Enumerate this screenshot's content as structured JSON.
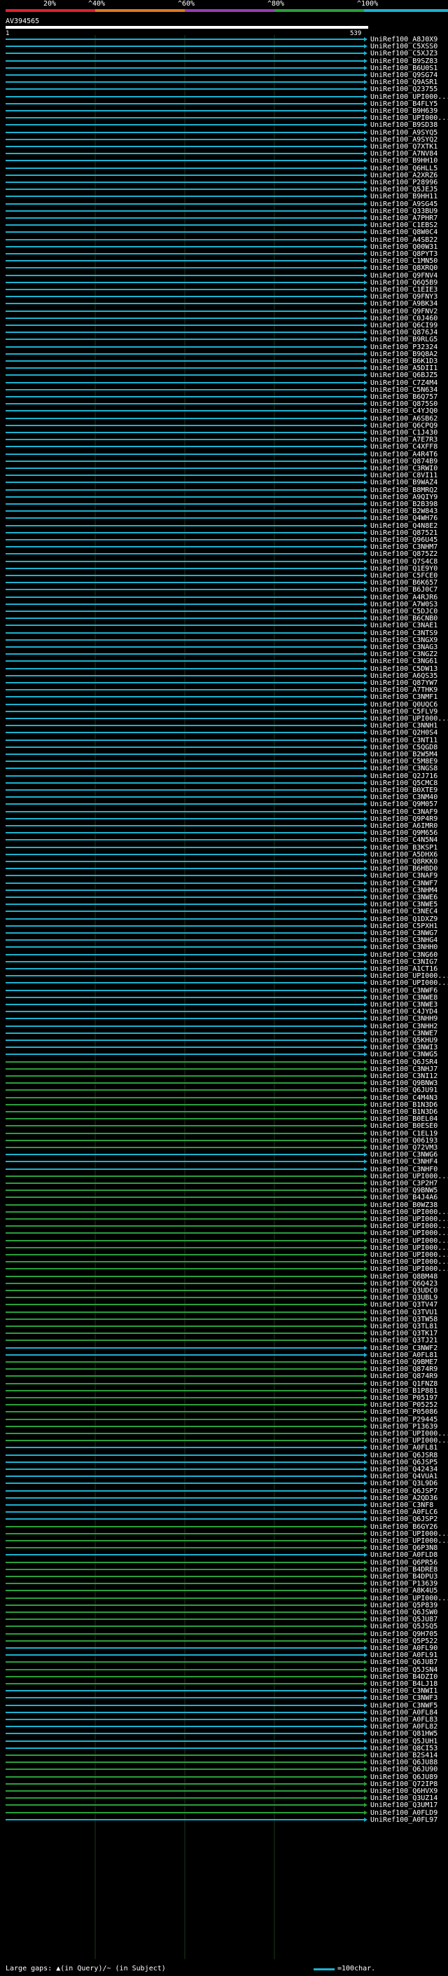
{
  "legend": {
    "labels": [
      "20%",
      "^40%",
      "^60%",
      "^80%",
      "^100%"
    ],
    "colors": [
      "#e0202c",
      "#e07820",
      "#9b3bb5",
      "#28a03c",
      "#1ab3d1"
    ]
  },
  "query": {
    "title": "AV394565",
    "ruler_start": "1",
    "ruler_end": "539"
  },
  "hits": [
    {
      "label": "UniRef100_A8J0X9",
      "color": "blue"
    },
    {
      "label": "UniRef100_C5XSS0",
      "color": "blue"
    },
    {
      "label": "UniRef100_C5XJZ3",
      "color": "blue"
    },
    {
      "label": "UniRef100_B9SZ83",
      "color": "blue"
    },
    {
      "label": "UniRef100_B6U0S1",
      "color": "blue"
    },
    {
      "label": "UniRef100_Q9SG74",
      "color": "blue"
    },
    {
      "label": "UniRef100_Q9ASR1",
      "color": "blue"
    },
    {
      "label": "UniRef100_Q23755",
      "color": "blue"
    },
    {
      "label": "UniRef100_UPI000...",
      "color": "blue"
    },
    {
      "label": "UniRef100_B4FLY5",
      "color": "blue"
    },
    {
      "label": "UniRef100_B9H639",
      "color": "blue"
    },
    {
      "label": "UniRef100_UPI000...",
      "color": "blue"
    },
    {
      "label": "UniRef100_B9SD38",
      "color": "blue"
    },
    {
      "label": "UniRef100_A9SYQ5",
      "color": "blue"
    },
    {
      "label": "UniRef100_A9SYQ2",
      "color": "blue"
    },
    {
      "label": "UniRef100_Q7XTK1",
      "color": "blue"
    },
    {
      "label": "UniRef100_A7NV84",
      "color": "blue"
    },
    {
      "label": "UniRef100_B9HH10",
      "color": "blue"
    },
    {
      "label": "UniRef100_Q6HLL5",
      "color": "blue"
    },
    {
      "label": "UniRef100_A2XRZ6",
      "color": "blue"
    },
    {
      "label": "UniRef100_P28996",
      "color": "blue"
    },
    {
      "label": "UniRef100_Q5JEJ5",
      "color": "blue"
    },
    {
      "label": "UniRef100_B9HH11",
      "color": "blue"
    },
    {
      "label": "UniRef100_A9SG45",
      "color": "blue"
    },
    {
      "label": "UniRef100_Q33BU9",
      "color": "blue"
    },
    {
      "label": "UniRef100_A7PHR7",
      "color": "blue"
    },
    {
      "label": "UniRef100_C1EBS2",
      "color": "blue"
    },
    {
      "label": "UniRef100_Q8W0C4",
      "color": "blue"
    },
    {
      "label": "UniRef100_A4SB22",
      "color": "blue"
    },
    {
      "label": "UniRef100_Q00W31",
      "color": "blue"
    },
    {
      "label": "UniRef100_Q8PYT3",
      "color": "blue"
    },
    {
      "label": "UniRef100_C1MN50",
      "color": "blue"
    },
    {
      "label": "UniRef100_Q8XRQ0",
      "color": "blue"
    },
    {
      "label": "UniRef100_Q9FNV4",
      "color": "blue"
    },
    {
      "label": "UniRef100_Q6Q5B9",
      "color": "blue"
    },
    {
      "label": "UniRef100_C1EIE3",
      "color": "blue"
    },
    {
      "label": "UniRef100_Q9FNY3",
      "color": "blue"
    },
    {
      "label": "UniRef100_A9BK34",
      "color": "blue"
    },
    {
      "label": "UniRef100_Q9FNV2",
      "color": "blue"
    },
    {
      "label": "UniRef100_C0J460",
      "color": "blue"
    },
    {
      "label": "UniRef100_Q6CI99",
      "color": "blue"
    },
    {
      "label": "UniRef100_Q876J4",
      "color": "blue"
    },
    {
      "label": "UniRef100_B9RLG5",
      "color": "blue"
    },
    {
      "label": "UniRef100_P32324",
      "color": "blue"
    },
    {
      "label": "UniRef100_B9Q8A2",
      "color": "blue"
    },
    {
      "label": "UniRef100_B6K1D3",
      "color": "blue"
    },
    {
      "label": "UniRef100_A5DII1",
      "color": "blue"
    },
    {
      "label": "UniRef100_Q6BJZ5",
      "color": "blue"
    },
    {
      "label": "UniRef100_C7Z4M4",
      "color": "blue"
    },
    {
      "label": "UniRef100_C5N634",
      "color": "blue"
    },
    {
      "label": "UniRef100_B6Q757",
      "color": "blue"
    },
    {
      "label": "UniRef100_Q875S0",
      "color": "blue"
    },
    {
      "label": "UniRef100_C4YJQ0",
      "color": "blue"
    },
    {
      "label": "UniRef100_A6SB62",
      "color": "blue"
    },
    {
      "label": "UniRef100_Q6CPQ9",
      "color": "blue"
    },
    {
      "label": "UniRef100_C1J430",
      "color": "blue"
    },
    {
      "label": "UniRef100_A7E7R3",
      "color": "blue"
    },
    {
      "label": "UniRef100_C4XFF8",
      "color": "blue"
    },
    {
      "label": "UniRef100_A4R4T6",
      "color": "blue"
    },
    {
      "label": "UniRef100_Q874B9",
      "color": "blue"
    },
    {
      "label": "UniRef100_C3RWI0",
      "color": "blue"
    },
    {
      "label": "UniRef100_C8VI11",
      "color": "blue"
    },
    {
      "label": "UniRef100_B9WAZ4",
      "color": "blue"
    },
    {
      "label": "UniRef100_B8MRQ2",
      "color": "blue"
    },
    {
      "label": "UniRef100_A9QIY9",
      "color": "blue"
    },
    {
      "label": "UniRef100_B2B398",
      "color": "blue"
    },
    {
      "label": "UniRef100_B2W843",
      "color": "blue"
    },
    {
      "label": "UniRef100_Q4WH76",
      "color": "blue"
    },
    {
      "label": "UniRef100_Q4N8E2",
      "color": "blue"
    },
    {
      "label": "UniRef100_Q87521",
      "color": "blue"
    },
    {
      "label": "UniRef100_Q96U45",
      "color": "blue"
    },
    {
      "label": "UniRef100_C3NHM7",
      "color": "blue"
    },
    {
      "label": "UniRef100_Q875Z2",
      "color": "blue"
    },
    {
      "label": "UniRef100_Q7S4C8",
      "color": "blue"
    },
    {
      "label": "UniRef100_Q1E9Y0",
      "color": "blue"
    },
    {
      "label": "UniRef100_C5FCE0",
      "color": "blue"
    },
    {
      "label": "UniRef100_B6K657",
      "color": "blue"
    },
    {
      "label": "UniRef100_B6J0C7",
      "color": "blue"
    },
    {
      "label": "UniRef100_A4RJR6",
      "color": "blue"
    },
    {
      "label": "UniRef100_A7W0S3",
      "color": "blue"
    },
    {
      "label": "UniRef100_C5DJC0",
      "color": "blue"
    },
    {
      "label": "UniRef100_B6CNB0",
      "color": "blue"
    },
    {
      "label": "UniRef100_C3NAE1",
      "color": "blue"
    },
    {
      "label": "UniRef100_C3NTS9",
      "color": "blue"
    },
    {
      "label": "UniRef100_C3NGX9",
      "color": "blue"
    },
    {
      "label": "UniRef100_C3NAG3",
      "color": "blue"
    },
    {
      "label": "UniRef100_C3NGZ2",
      "color": "blue"
    },
    {
      "label": "UniRef100_C3NG61",
      "color": "blue"
    },
    {
      "label": "UniRef100_C5DW13",
      "color": "blue"
    },
    {
      "label": "UniRef100_A6QS35",
      "color": "blue"
    },
    {
      "label": "UniRef100_Q87YW7",
      "color": "blue"
    },
    {
      "label": "UniRef100_A7THK9",
      "color": "blue"
    },
    {
      "label": "UniRef100_C3NMF1",
      "color": "blue"
    },
    {
      "label": "UniRef100_Q0UQC6",
      "color": "blue"
    },
    {
      "label": "UniRef100_C5FLV9",
      "color": "blue"
    },
    {
      "label": "UniRef100_UPI000...",
      "color": "blue"
    },
    {
      "label": "UniRef100_C3NNH1",
      "color": "blue"
    },
    {
      "label": "UniRef100_Q2H0S4",
      "color": "blue"
    },
    {
      "label": "UniRef100_C3NT11",
      "color": "blue"
    },
    {
      "label": "UniRef100_C5QGD8",
      "color": "blue"
    },
    {
      "label": "UniRef100_B2W5M4",
      "color": "blue"
    },
    {
      "label": "UniRef100_C5M8E9",
      "color": "blue"
    },
    {
      "label": "UniRef100_C3NGS8",
      "color": "blue"
    },
    {
      "label": "UniRef100_Q2J716",
      "color": "blue"
    },
    {
      "label": "UniRef100_Q5CMC8",
      "color": "blue"
    },
    {
      "label": "UniRef100_B0XTE9",
      "color": "blue"
    },
    {
      "label": "UniRef100_C3NM40",
      "color": "blue"
    },
    {
      "label": "UniRef100_Q9M057",
      "color": "blue"
    },
    {
      "label": "UniRef100_C3NAF9",
      "color": "blue"
    },
    {
      "label": "UniRef100_Q9P4R9",
      "color": "blue"
    },
    {
      "label": "UniRef100_A6IMR0",
      "color": "blue"
    },
    {
      "label": "UniRef100_Q9M656",
      "color": "blue"
    },
    {
      "label": "UniRef100_C4N5N4",
      "color": "blue"
    },
    {
      "label": "UniRef100_B3KSP1",
      "color": "blue"
    },
    {
      "label": "UniRef100_A5DHX6",
      "color": "blue"
    },
    {
      "label": "UniRef100_Q8RKK0",
      "color": "blue"
    },
    {
      "label": "UniRef100_B6HBD0",
      "color": "blue"
    },
    {
      "label": "UniRef100_C3NAF9",
      "color": "blue"
    },
    {
      "label": "UniRef100_C3NWF7",
      "color": "blue"
    },
    {
      "label": "UniRef100_C3NHM4",
      "color": "blue"
    },
    {
      "label": "UniRef100_C3NWE6",
      "color": "blue"
    },
    {
      "label": "UniRef100_C3NWE5",
      "color": "blue"
    },
    {
      "label": "UniRef100_C3NEC4",
      "color": "blue"
    },
    {
      "label": "UniRef100_Q1DXZ9",
      "color": "blue"
    },
    {
      "label": "UniRef100_C5PXH1",
      "color": "blue"
    },
    {
      "label": "UniRef100_C3NWG7",
      "color": "blue"
    },
    {
      "label": "UniRef100_C3NHG4",
      "color": "blue"
    },
    {
      "label": "UniRef100_C3NHH0",
      "color": "blue"
    },
    {
      "label": "UniRef100_C3NG60",
      "color": "blue"
    },
    {
      "label": "UniRef100_C3NIG7",
      "color": "blue"
    },
    {
      "label": "UniRef100_A1CT16",
      "color": "blue"
    },
    {
      "label": "UniRef100_UPI000...",
      "color": "blue"
    },
    {
      "label": "UniRef100_UPI000...",
      "color": "blue"
    },
    {
      "label": "UniRef100_C3NWF6",
      "color": "blue"
    },
    {
      "label": "UniRef100_C3NWE8",
      "color": "blue"
    },
    {
      "label": "UniRef100_C3NWE3",
      "color": "blue"
    },
    {
      "label": "UniRef100_C4JYD4",
      "color": "blue"
    },
    {
      "label": "UniRef100_C3NHH9",
      "color": "blue"
    },
    {
      "label": "UniRef100_C3NHH2",
      "color": "blue"
    },
    {
      "label": "UniRef100_C3NWE7",
      "color": "blue"
    },
    {
      "label": "UniRef100_Q5KHU9",
      "color": "blue"
    },
    {
      "label": "UniRef100_C3NWI3",
      "color": "blue"
    },
    {
      "label": "UniRef100_C3NWG5",
      "color": "blue"
    },
    {
      "label": "UniRef100_Q6JSR4",
      "color": "green"
    },
    {
      "label": "UniRef100_C3NHJ7",
      "color": "green"
    },
    {
      "label": "UniRef100_C3NI12",
      "color": "green"
    },
    {
      "label": "UniRef100_Q9BNW3",
      "color": "green"
    },
    {
      "label": "UniRef100_Q6JU91",
      "color": "green"
    },
    {
      "label": "UniRef100_C4M4N3",
      "color": "green"
    },
    {
      "label": "UniRef100_B1N3D6",
      "color": "green"
    },
    {
      "label": "UniRef100_B1N3D6",
      "color": "green"
    },
    {
      "label": "UniRef100_B0EL04",
      "color": "green"
    },
    {
      "label": "UniRef100_B0ESE0",
      "color": "green"
    },
    {
      "label": "UniRef100_C1EL19",
      "color": "green"
    },
    {
      "label": "UniRef100_Q06193",
      "color": "green"
    },
    {
      "label": "UniRef100_Q72VM3",
      "color": "green"
    },
    {
      "label": "UniRef100_C3NWG6",
      "color": "blue"
    },
    {
      "label": "UniRef100_C3NHF4",
      "color": "blue"
    },
    {
      "label": "UniRef100_C3NHF0",
      "color": "blue"
    },
    {
      "label": "UniRef100_UPI000...",
      "color": "green"
    },
    {
      "label": "UniRef100_C3P2H7",
      "color": "green"
    },
    {
      "label": "UniRef100_Q9BNW5",
      "color": "green"
    },
    {
      "label": "UniRef100_B4J4A6",
      "color": "green"
    },
    {
      "label": "UniRef100_B0WZ38",
      "color": "green"
    },
    {
      "label": "UniRef100_UPI000...",
      "color": "green"
    },
    {
      "label": "UniRef100_UPI000...",
      "color": "green"
    },
    {
      "label": "UniRef100_UPI000...",
      "color": "green"
    },
    {
      "label": "UniRef100_UPI000...",
      "color": "green"
    },
    {
      "label": "UniRef100_UPI000...",
      "color": "green"
    },
    {
      "label": "UniRef100_UPI000...",
      "color": "green"
    },
    {
      "label": "UniRef100_UPI000...",
      "color": "green"
    },
    {
      "label": "UniRef100_UPI000...",
      "color": "green"
    },
    {
      "label": "UniRef100_UPI000...",
      "color": "green"
    },
    {
      "label": "UniRef100_Q8BM48",
      "color": "green"
    },
    {
      "label": "UniRef100_Q6Q423",
      "color": "green"
    },
    {
      "label": "UniRef100_Q3UDC0",
      "color": "green"
    },
    {
      "label": "UniRef100_Q3UBL9",
      "color": "green"
    },
    {
      "label": "UniRef100_Q3TV47",
      "color": "green"
    },
    {
      "label": "UniRef100_Q3TVU1",
      "color": "green"
    },
    {
      "label": "UniRef100_Q3TW58",
      "color": "green"
    },
    {
      "label": "UniRef100_Q3TL81",
      "color": "green"
    },
    {
      "label": "UniRef100_Q3TK17",
      "color": "green"
    },
    {
      "label": "UniRef100_Q3TJ21",
      "color": "green"
    },
    {
      "label": "UniRef100_C3NWF2",
      "color": "blue"
    },
    {
      "label": "UniRef100_A0FL81",
      "color": "blue"
    },
    {
      "label": "UniRef100_Q9BME7",
      "color": "green"
    },
    {
      "label": "UniRef100_Q874R9",
      "color": "green"
    },
    {
      "label": "UniRef100_Q874R9",
      "color": "green"
    },
    {
      "label": "UniRef100_Q1FNZ8",
      "color": "green"
    },
    {
      "label": "UniRef100_B1P881",
      "color": "green"
    },
    {
      "label": "UniRef100_P05197",
      "color": "green"
    },
    {
      "label": "UniRef100_P05252",
      "color": "green"
    },
    {
      "label": "UniRef100_P05086",
      "color": "green"
    },
    {
      "label": "UniRef100_P29445",
      "color": "green"
    },
    {
      "label": "UniRef100_P13639",
      "color": "green"
    },
    {
      "label": "UniRef100_UPI000...",
      "color": "green"
    },
    {
      "label": "UniRef100_UPI000...",
      "color": "green"
    },
    {
      "label": "UniRef100_A0FL81",
      "color": "blue"
    },
    {
      "label": "UniRef100_Q6JSR8",
      "color": "blue"
    },
    {
      "label": "UniRef100_Q6JSP5",
      "color": "blue"
    },
    {
      "label": "UniRef100_Q42434",
      "color": "blue"
    },
    {
      "label": "UniRef100_Q4VUA1",
      "color": "blue"
    },
    {
      "label": "UniRef100_Q3L9D6",
      "color": "blue"
    },
    {
      "label": "UniRef100_Q6JSP7",
      "color": "blue"
    },
    {
      "label": "UniRef100_A2QD36",
      "color": "blue"
    },
    {
      "label": "UniRef100_C3NF8",
      "color": "blue"
    },
    {
      "label": "UniRef100_A0FLC6",
      "color": "blue"
    },
    {
      "label": "UniRef100_Q6JSP2",
      "color": "blue"
    },
    {
      "label": "UniRef100_B6GY26",
      "color": "green"
    },
    {
      "label": "UniRef100_UPI000...",
      "color": "green"
    },
    {
      "label": "UniRef100_UPI000...",
      "color": "green"
    },
    {
      "label": "UniRef100_Q6P3N8",
      "color": "green"
    },
    {
      "label": "UniRef100_A0FLD8",
      "color": "blue"
    },
    {
      "label": "UniRef100_Q6PR56",
      "color": "green"
    },
    {
      "label": "UniRef100_B4DRE8",
      "color": "green"
    },
    {
      "label": "UniRef100_B4DPU3",
      "color": "green"
    },
    {
      "label": "UniRef100_P13639",
      "color": "green"
    },
    {
      "label": "UniRef100_A8K4U5",
      "color": "green"
    },
    {
      "label": "UniRef100_UPI000...",
      "color": "green"
    },
    {
      "label": "UniRef100_Q5P839",
      "color": "green"
    },
    {
      "label": "UniRef100_Q6JSW0",
      "color": "green"
    },
    {
      "label": "UniRef100_Q5JU87",
      "color": "green"
    },
    {
      "label": "UniRef100_Q5JSQ5",
      "color": "green"
    },
    {
      "label": "UniRef100_Q9H705",
      "color": "green"
    },
    {
      "label": "UniRef100_Q5P522",
      "color": "green"
    },
    {
      "label": "UniRef100_A0FL90",
      "color": "blue"
    },
    {
      "label": "UniRef100_A0FL91",
      "color": "blue"
    },
    {
      "label": "UniRef100_Q6JUB7",
      "color": "green"
    },
    {
      "label": "UniRef100_Q5JSN4",
      "color": "green"
    },
    {
      "label": "UniRef100_B4DZI0",
      "color": "green"
    },
    {
      "label": "UniRef100_B4LJ18",
      "color": "green"
    },
    {
      "label": "UniRef100_C3NWI1",
      "color": "blue"
    },
    {
      "label": "UniRef100_C3NWF3",
      "color": "blue"
    },
    {
      "label": "UniRef100_C3NWF5",
      "color": "blue"
    },
    {
      "label": "UniRef100_A0FL84",
      "color": "blue"
    },
    {
      "label": "UniRef100_A0FL83",
      "color": "blue"
    },
    {
      "label": "UniRef100_A0FL82",
      "color": "blue"
    },
    {
      "label": "UniRef100_Q81HW5",
      "color": "blue"
    },
    {
      "label": "UniRef100_Q5JUH1",
      "color": "blue"
    },
    {
      "label": "UniRef100_Q8CI53",
      "color": "blue"
    },
    {
      "label": "UniRef100_B2S414",
      "color": "green"
    },
    {
      "label": "UniRef100_Q6JU88",
      "color": "green"
    },
    {
      "label": "UniRef100_Q6JU90",
      "color": "green"
    },
    {
      "label": "UniRef100_Q6JU89",
      "color": "green"
    },
    {
      "label": "UniRef100_Q72IP8",
      "color": "green"
    },
    {
      "label": "UniRef100_Q6HVX9",
      "color": "green"
    },
    {
      "label": "UniRef100_Q3UZ14",
      "color": "green"
    },
    {
      "label": "UniRef100_Q3UM17",
      "color": "green"
    },
    {
      "label": "UniRef100_A0FLD9",
      "color": "green"
    },
    {
      "label": "UniRef100_A0FL97",
      "color": "blue"
    }
  ],
  "footer": {
    "text": "Large gaps: ▲(in Query)/~ (in Subject)",
    "scale": "=100char."
  }
}
